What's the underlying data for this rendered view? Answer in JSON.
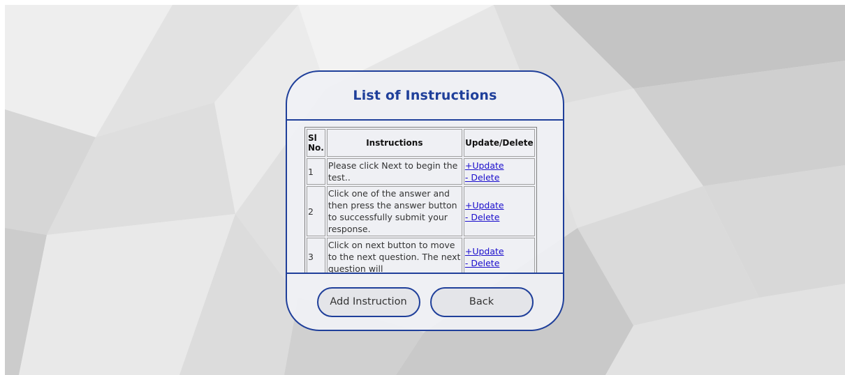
{
  "card": {
    "title": "List of Instructions"
  },
  "table": {
    "headers": {
      "sl_no": "Sl No.",
      "instructions": "Instructions",
      "actions": "Update/Delete"
    },
    "rows": [
      {
        "sl": "1",
        "text": "Please click Next to begin the test..",
        "update": "+Update",
        "delete": "- Delete"
      },
      {
        "sl": "2",
        "text": "Click one of the answer and then press the answer button to successfully submit your response.",
        "update": "+Update",
        "delete": "- Delete"
      },
      {
        "sl": "3",
        "text": "Click on next button to move to the next question. The next question will",
        "update": "+Update",
        "delete": "- Delete"
      }
    ]
  },
  "buttons": {
    "add": "Add Instruction",
    "back": "Back"
  },
  "colors": {
    "accent": "#1f3f9a",
    "link": "#1a0dcc",
    "background": "#e6e6e6"
  }
}
